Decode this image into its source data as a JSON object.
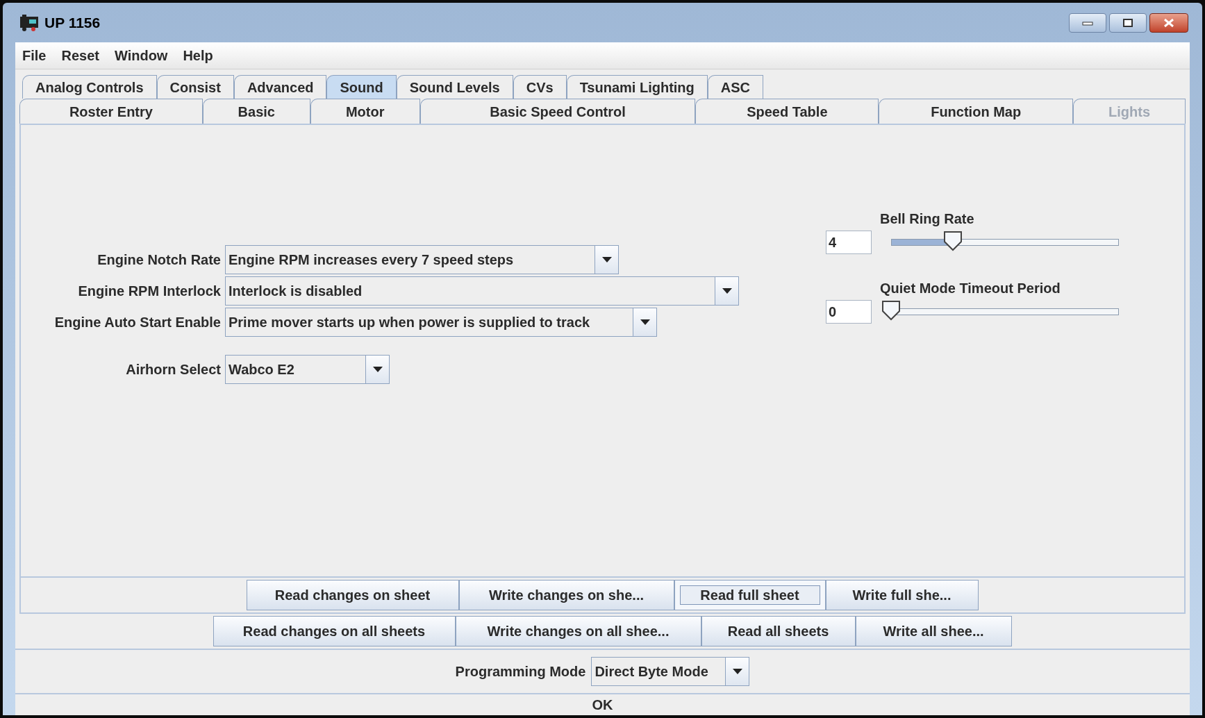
{
  "window": {
    "title": "UP 1156"
  },
  "menu": [
    "File",
    "Reset",
    "Window",
    "Help"
  ],
  "tab_rows": [
    [
      {
        "label": "Analog Controls",
        "selected": false,
        "disabled": false
      },
      {
        "label": "Consist",
        "selected": false,
        "disabled": false
      },
      {
        "label": "Advanced",
        "selected": false,
        "disabled": false
      },
      {
        "label": "Sound",
        "selected": true,
        "disabled": false
      },
      {
        "label": "Sound Levels",
        "selected": false,
        "disabled": false
      },
      {
        "label": "CVs",
        "selected": false,
        "disabled": false
      },
      {
        "label": "Tsunami Lighting",
        "selected": false,
        "disabled": false
      },
      {
        "label": "ASC",
        "selected": false,
        "disabled": false
      }
    ],
    [
      {
        "label": "Roster Entry",
        "selected": false,
        "disabled": false
      },
      {
        "label": "Basic",
        "selected": false,
        "disabled": false
      },
      {
        "label": "Motor",
        "selected": false,
        "disabled": false
      },
      {
        "label": "Basic Speed Control",
        "selected": false,
        "disabled": false
      },
      {
        "label": "Speed Table",
        "selected": false,
        "disabled": false
      },
      {
        "label": "Function Map",
        "selected": false,
        "disabled": false
      },
      {
        "label": "Lights",
        "selected": false,
        "disabled": true
      }
    ]
  ],
  "settings": [
    {
      "label": "Engine Notch Rate",
      "value": "Engine RPM increases every 7 speed steps"
    },
    {
      "label": "Engine RPM Interlock",
      "value": "Interlock is disabled"
    },
    {
      "label": "Engine Auto Start Enable",
      "value": "Prime mover starts up when power is supplied to track"
    },
    {
      "label": "Airhorn Select",
      "value": "Wabco E2"
    }
  ],
  "sliders": [
    {
      "label": "Bell Ring Rate",
      "value": "4",
      "level": 0.27
    },
    {
      "label": "Quiet Mode Timeout Period",
      "value": "0",
      "level": 0
    }
  ],
  "sheet_buttons": [
    {
      "label": "Read changes on sheet",
      "focused": false
    },
    {
      "label": "Write changes on she...",
      "focused": false
    },
    {
      "label": "Read full sheet",
      "focused": true
    },
    {
      "label": "Write full she...",
      "focused": false
    }
  ],
  "all_buttons": [
    {
      "label": "Read changes on all sheets",
      "focused": false
    },
    {
      "label": "Write changes on all shee...",
      "focused": false
    },
    {
      "label": "Read all sheets",
      "focused": false
    },
    {
      "label": "Write all shee...",
      "focused": false
    }
  ],
  "programming_mode": {
    "label": "Programming Mode",
    "value": "Direct Byte Mode"
  },
  "status": "OK"
}
